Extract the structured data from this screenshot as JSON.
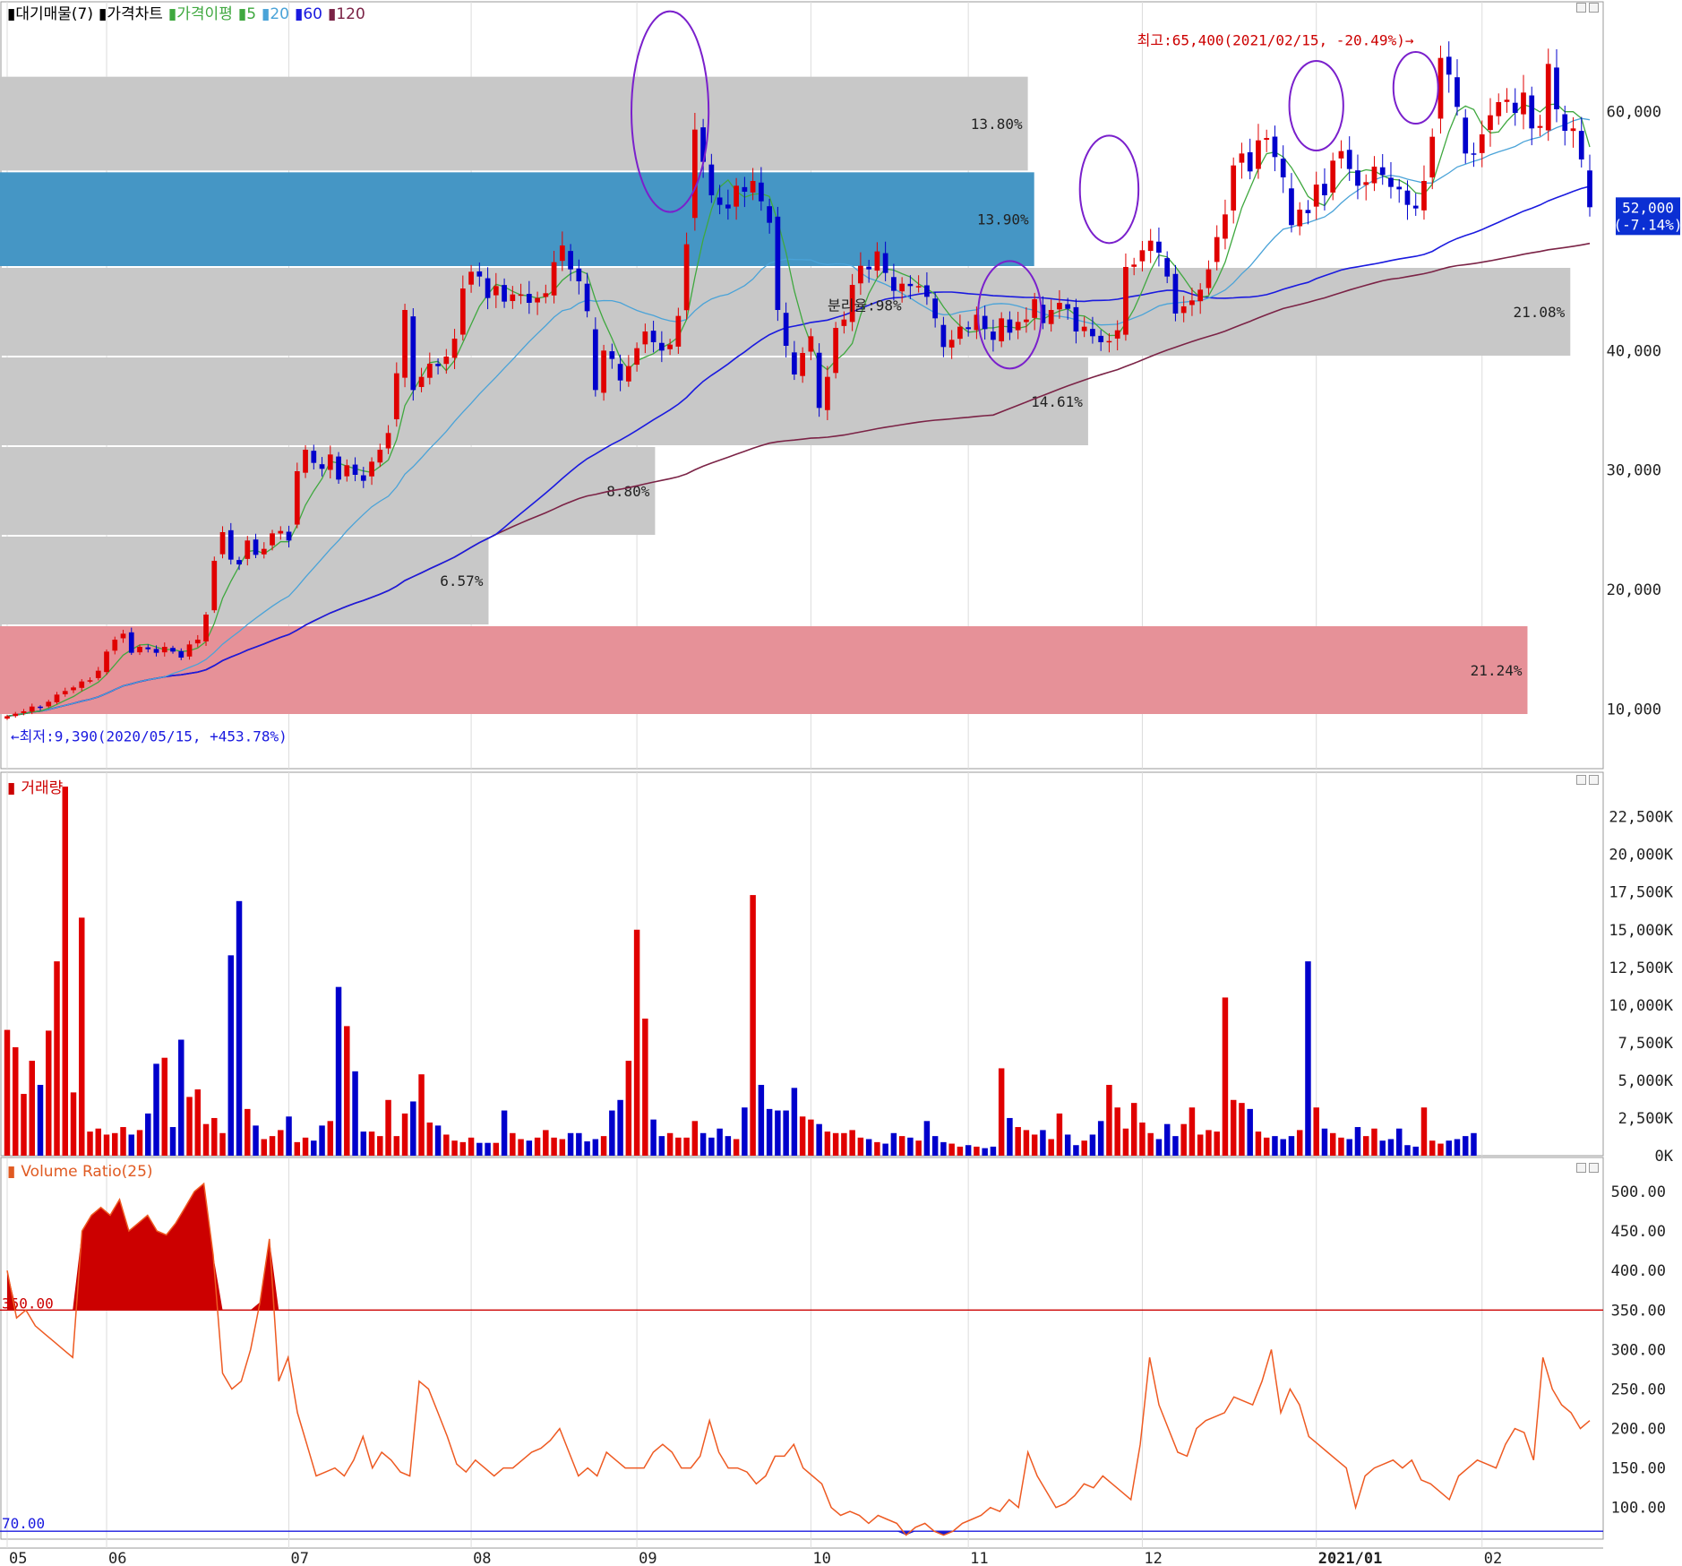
{
  "colors": {
    "up": "#e00000",
    "down": "#0000cc",
    "ma5": "#3fa83f",
    "ma20": "#4aa3d8",
    "ma60": "#1a1adf",
    "ma120": "#7b2346",
    "zone": "#c8c8c8",
    "zone_current": "#4596c5",
    "zone_low": "#e69198",
    "vr_line": "#ee5a22",
    "vr_fill": "#cc0000",
    "hi_line": "#cc0000",
    "lo_line": "#1a1adf",
    "ellipse": "#7a20cc"
  },
  "price_panel": {
    "legend": [
      {
        "text": "대기매물(7)",
        "color": "#000000"
      },
      {
        "text": "가격차트",
        "color": "#000000"
      },
      {
        "text": "가격이평",
        "color": "#3fa83f"
      },
      {
        "text": "5",
        "color": "#3fa83f"
      },
      {
        "text": "20",
        "color": "#4aa3d8"
      },
      {
        "text": "60",
        "color": "#1a1adf"
      },
      {
        "text": "120",
        "color": "#7b2346"
      }
    ],
    "high_label": "최고:65,400(2021/02/15, -20.49%)",
    "low_label": "최저:9,390(2020/05/15, +453.78%)",
    "center_label": "분리율:98%",
    "current_value": "52,000",
    "current_change": "(-7.14%)"
  },
  "volume_panel": {
    "title": "거래량"
  },
  "ratio_panel": {
    "title": "Volume Ratio(25)",
    "upper_label": "350.00",
    "lower_label": "70.00"
  },
  "chart_data": [
    {
      "type": "candlestick",
      "name": "price",
      "ylim": [
        5000,
        68000
      ],
      "yticks": [
        {
          "v": 10000,
          "label": "10,000"
        },
        {
          "v": 20000,
          "label": "20,000"
        },
        {
          "v": 30000,
          "label": "30,000"
        },
        {
          "v": 40000,
          "label": "40,000"
        },
        {
          "v": 60000,
          "label": "60,000"
        }
      ],
      "x_months": [
        {
          "d": 0,
          "label": "05"
        },
        {
          "d": 12,
          "label": "06"
        },
        {
          "d": 34,
          "label": "07"
        },
        {
          "d": 56,
          "label": "08"
        },
        {
          "d": 76,
          "label": "09"
        },
        {
          "d": 97,
          "label": "10"
        },
        {
          "d": 116,
          "label": "11"
        },
        {
          "d": 137,
          "label": "12"
        },
        {
          "d": 158,
          "label": "2021/01"
        },
        {
          "d": 178,
          "label": "02"
        }
      ],
      "closes": [
        9390,
        9600,
        9800,
        10200,
        10100,
        10600,
        11200,
        11500,
        11800,
        12300,
        12400,
        13200,
        14800,
        15800,
        16300,
        14700,
        15200,
        15000,
        14700,
        15200,
        14800,
        14300,
        15400,
        15800,
        17900,
        22400,
        24800,
        22500,
        22100,
        24100,
        22900,
        23400,
        24700,
        24900,
        24100,
        29900,
        31700,
        30600,
        30100,
        31300,
        29200,
        30400,
        29600,
        29100,
        30700,
        31700,
        33100,
        38100,
        43400,
        36700,
        37800,
        38900,
        38700,
        39500,
        41000,
        45200,
        46600,
        46200,
        44400,
        45400,
        44100,
        44700,
        44700,
        44000,
        44400,
        44800,
        47400,
        48800,
        46800,
        45800,
        43300,
        36700,
        40000,
        39300,
        37500,
        38700,
        40200,
        41600,
        40700,
        40000,
        40500,
        42900,
        48900,
        58500,
        55800,
        53000,
        52200,
        51900,
        53800,
        53300,
        54200,
        52500,
        50700,
        43400,
        40400,
        38000,
        39800,
        41200,
        35200,
        37800,
        41900,
        42600,
        45500,
        47100,
        46800,
        48300,
        46500,
        45000,
        45600,
        45400,
        45400,
        44500,
        42700,
        40300,
        40900,
        42000,
        41800,
        43000,
        41800,
        40900,
        42700,
        41500,
        42400,
        42600,
        44300,
        42300,
        43400,
        44000,
        43500,
        41600,
        42000,
        41200,
        40700,
        40800,
        41700,
        47000,
        47200,
        48400,
        49200,
        48200,
        46200,
        43100,
        43700,
        44200,
        45100,
        46800,
        49500,
        51400,
        55500,
        56500,
        55000,
        57600,
        57800,
        56200,
        54500,
        50500,
        51800,
        51500,
        53900,
        53000,
        55900,
        56700,
        55200,
        53800,
        54100,
        55400,
        54700,
        53700,
        53500,
        52200,
        51900,
        54200,
        57900,
        64500,
        63100,
        60400,
        56500,
        56400,
        58100,
        59700,
        60800,
        61000,
        59900,
        61600,
        58600,
        58800,
        64000,
        60200,
        58400,
        58600,
        56000,
        52000
      ],
      "volumes": [
        8350,
        7200,
        4100,
        6300,
        4700,
        8300,
        12900,
        24500,
        4200,
        15800,
        1600,
        1800,
        1400,
        1500,
        1900,
        1400,
        1700,
        2800,
        6100,
        6500,
        1900,
        7700,
        3900,
        4400,
        2100,
        2500,
        1500,
        13300,
        16900,
        3100,
        2000,
        1100,
        1300,
        1700,
        2600,
        900,
        1200,
        1000,
        2000,
        2300,
        11200,
        8600,
        5600,
        1600,
        1600,
        1300,
        3700,
        1300,
        2800,
        3600,
        5400,
        2200,
        2000,
        1400,
        1000,
        900,
        1200,
        850,
        850,
        850,
        3000,
        1500,
        1100,
        1000,
        1200,
        1700,
        1200,
        1100,
        1500,
        1500,
        950,
        1100,
        1300,
        3000,
        3700,
        6300,
        15000,
        9100,
        2400,
        1300,
        1500,
        1200,
        1200,
        2300,
        1500,
        1200,
        1800,
        1300,
        1100,
        3200,
        17300,
        4700,
        3100,
        3000,
        3000,
        4500,
        2600,
        2400,
        2100,
        1600,
        1500,
        1500,
        1700,
        1200,
        1100,
        900,
        800,
        1500,
        1300,
        1200,
        1000,
        2300,
        1300,
        900,
        800,
        600,
        700,
        600,
        500,
        600,
        5800,
        2500,
        1900,
        1700,
        1400,
        1700,
        1100,
        2800,
        1400,
        700,
        1000,
        1400,
        2300,
        4700,
        3200,
        1800,
        3500,
        2200,
        1500,
        1100,
        2100,
        1300,
        2100,
        3200,
        1400,
        1700,
        1600,
        10500,
        3700,
        3500,
        3100,
        1600,
        1200,
        1300,
        1100,
        1300,
        1700,
        12900,
        3200,
        1800,
        1500,
        1200,
        1100,
        1900,
        1300,
        1800,
        1000,
        1100,
        1800,
        700,
        600,
        3200,
        1000,
        800,
        1000,
        1100,
        1300,
        1500
      ],
      "ma_legend": [
        5,
        20,
        60,
        120
      ]
    },
    {
      "type": "bar",
      "name": "거래량",
      "ylim": [
        0,
        24500
      ],
      "yticks": [
        {
          "v": 0,
          "label": "0K"
        },
        {
          "v": 2500,
          "label": "2,500K"
        },
        {
          "v": 5000,
          "label": "5,000K"
        },
        {
          "v": 7500,
          "label": "7,500K"
        },
        {
          "v": 10000,
          "label": "10,000K"
        },
        {
          "v": 12500,
          "label": "12,500K"
        },
        {
          "v": 15000,
          "label": "15,000K"
        },
        {
          "v": 17500,
          "label": "17,500K"
        },
        {
          "v": 20000,
          "label": "20,000K"
        },
        {
          "v": 22500,
          "label": "22,500K"
        }
      ]
    },
    {
      "type": "area",
      "name": "Volume Ratio(25)",
      "ylim": [
        60,
        525
      ],
      "upper": 350,
      "lower": 70,
      "yticks": [
        {
          "v": 100,
          "label": "100.00"
        },
        {
          "v": 150,
          "label": "150.00"
        },
        {
          "v": 200,
          "label": "200.00"
        },
        {
          "v": 250,
          "label": "250.00"
        },
        {
          "v": 300,
          "label": "300.00"
        },
        {
          "v": 350,
          "label": "350.00"
        },
        {
          "v": 400,
          "label": "400.00"
        },
        {
          "v": 450,
          "label": "450.00"
        },
        {
          "v": 500,
          "label": "500.00"
        }
      ],
      "values": [
        400,
        340,
        350,
        330,
        320,
        310,
        300,
        290,
        450,
        470,
        480,
        470,
        490,
        450,
        460,
        470,
        450,
        445,
        460,
        480,
        500,
        510,
        420,
        270,
        250,
        260,
        300,
        360,
        440,
        260,
        290,
        220,
        180,
        140,
        145,
        150,
        140,
        160,
        190,
        150,
        170,
        160,
        145,
        140,
        260,
        250,
        220,
        190,
        155,
        145,
        160,
        150,
        140,
        150,
        150,
        160,
        170,
        175,
        185,
        200,
        170,
        140,
        150,
        140,
        170,
        160,
        150,
        150,
        150,
        170,
        180,
        170,
        150,
        150,
        165,
        210,
        170,
        150,
        150,
        145,
        130,
        140,
        165,
        165,
        180,
        150,
        140,
        130,
        100,
        90,
        95,
        90,
        80,
        90,
        85,
        80,
        65,
        75,
        80,
        70,
        65,
        70,
        80,
        85,
        90,
        100,
        95,
        110,
        100,
        170,
        140,
        120,
        100,
        105,
        115,
        130,
        125,
        140,
        130,
        120,
        110,
        180,
        290,
        230,
        200,
        170,
        165,
        200,
        210,
        215,
        220,
        240,
        235,
        230,
        260,
        300,
        220,
        250,
        230,
        190,
        180,
        170,
        160,
        150,
        100,
        140,
        150,
        155,
        160,
        150,
        160,
        135,
        130,
        120,
        110,
        140,
        150,
        160,
        155,
        150,
        180,
        200,
        195,
        160,
        290,
        250,
        230,
        220,
        200,
        210
      ]
    }
  ],
  "supply_zones": [
    {
      "lo": 55000,
      "hi": 63000,
      "pct": "13.80%",
      "len": 0.648,
      "kind": "normal"
    },
    {
      "lo": 47000,
      "hi": 55000,
      "pct": "13.90%",
      "len": 0.652,
      "kind": "current"
    },
    {
      "lo": 39500,
      "hi": 47000,
      "pct": "21.08%",
      "len": 0.99,
      "kind": "normal"
    },
    {
      "lo": 32000,
      "hi": 39500,
      "pct": "14.61%",
      "len": 0.686,
      "kind": "normal"
    },
    {
      "lo": 24500,
      "hi": 32000,
      "pct": "8.80%",
      "len": 0.413,
      "kind": "normal"
    },
    {
      "lo": 17000,
      "hi": 24500,
      "pct": "6.57%",
      "len": 0.308,
      "kind": "normal"
    },
    {
      "lo": 9500,
      "hi": 17000,
      "pct": "21.24%",
      "len": 0.963,
      "kind": "low"
    }
  ]
}
